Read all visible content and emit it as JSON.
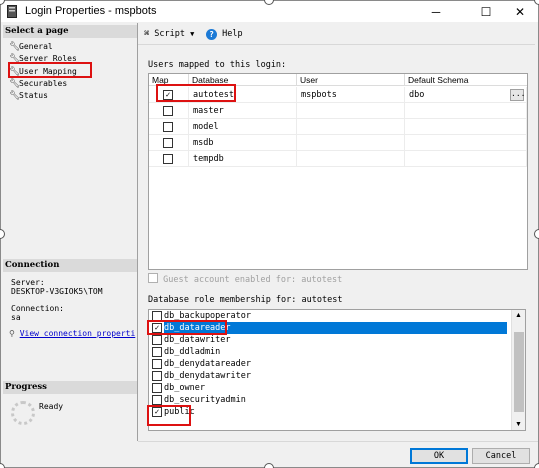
{
  "window": {
    "title": "Login Properties - mspbots",
    "minimize": "─",
    "maximize": "☐",
    "close": "✕"
  },
  "left_panel": {
    "select_page_title": "Select a page",
    "pages": [
      {
        "label": "General",
        "icon": "wrench-icon"
      },
      {
        "label": "Server Roles",
        "icon": "wrench-icon"
      },
      {
        "label": "User Mapping",
        "icon": "wrench-icon"
      },
      {
        "label": "Securables",
        "icon": "wrench-icon"
      },
      {
        "label": "Status",
        "icon": "wrench-icon"
      }
    ],
    "connection_title": "Connection",
    "server_label": "Server:",
    "server_value": "DESKTOP-V3GIOK5\\TOM",
    "connection_label": "Connection:",
    "connection_value": "sa",
    "view_conn_link": "View connection properti",
    "progress_title": "Progress",
    "progress_status": "Ready"
  },
  "toolbar": {
    "script_label": "Script",
    "help_label": "Help"
  },
  "users_mapped": {
    "label": "Users mapped to this login:",
    "columns": [
      "Map",
      "Database",
      "User",
      "Default Schema"
    ],
    "rows": [
      {
        "checked": true,
        "database": "autotest",
        "user": "mspbots",
        "schema": "dbo"
      },
      {
        "checked": false,
        "database": "master",
        "user": "",
        "schema": ""
      },
      {
        "checked": false,
        "database": "model",
        "user": "",
        "schema": ""
      },
      {
        "checked": false,
        "database": "msdb",
        "user": "",
        "schema": ""
      },
      {
        "checked": false,
        "database": "tempdb",
        "user": "",
        "schema": ""
      }
    ],
    "ellipsis": "..."
  },
  "guest": {
    "label": "Guest account enabled for: autotest",
    "checked": false
  },
  "role_membership": {
    "label": "Database role membership for: autotest",
    "roles": [
      {
        "name": "db_backupoperator",
        "checked": false,
        "selected": false
      },
      {
        "name": "db_datareader",
        "checked": true,
        "selected": true
      },
      {
        "name": "db_datawriter",
        "checked": false,
        "selected": false
      },
      {
        "name": "db_ddladmin",
        "checked": false,
        "selected": false
      },
      {
        "name": "db_denydatareader",
        "checked": false,
        "selected": false
      },
      {
        "name": "db_denydatawriter",
        "checked": false,
        "selected": false
      },
      {
        "name": "db_owner",
        "checked": false,
        "selected": false
      },
      {
        "name": "db_securityadmin",
        "checked": false,
        "selected": false
      },
      {
        "name": "public",
        "checked": true,
        "selected": false
      }
    ]
  },
  "footer": {
    "ok_label": "OK",
    "cancel_label": "Cancel"
  },
  "colors": {
    "selection": "#0078d7",
    "highlight_annotation": "#dd1111",
    "link": "#0000cc"
  }
}
